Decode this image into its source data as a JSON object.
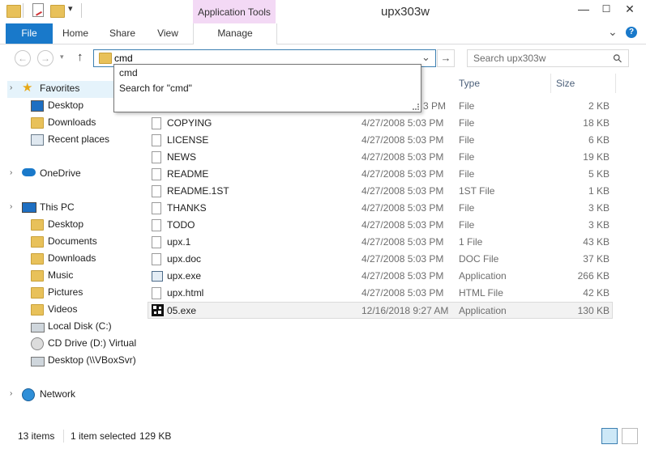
{
  "window": {
    "title": "upx303w",
    "minimize_glyph": "—",
    "maximize_glyph": "☐",
    "close_glyph": "✕"
  },
  "ribbon": {
    "context_group": "Application Tools",
    "tabs": {
      "file": "File",
      "home": "Home",
      "share": "Share",
      "view": "View",
      "manage": "Manage"
    },
    "collapse_glyph": "⌄",
    "help_glyph": "?"
  },
  "address_bar": {
    "value": "cmd",
    "back_glyph": "←",
    "forward_glyph": "→",
    "up_glyph": "↑",
    "dropdown_glyph": "⌄",
    "go_glyph": "→"
  },
  "search": {
    "placeholder": "Search upx303w",
    "icon_glyph": "⚲"
  },
  "autocomplete": {
    "items": [
      "cmd",
      "Search for \"cmd\""
    ]
  },
  "nav_pane": {
    "favorites": "Favorites",
    "fav_items": [
      "Desktop",
      "Downloads",
      "Recent places"
    ],
    "onedrive": "OneDrive",
    "this_pc": "This PC",
    "pc_items": [
      "Desktop",
      "Documents",
      "Downloads",
      "Music",
      "Pictures",
      "Videos",
      "Local Disk (C:)",
      "CD Drive (D:) Virtual",
      "Desktop (\\\\VBoxSvr)"
    ],
    "network": "Network"
  },
  "columns": {
    "type": "Type",
    "size": "Size"
  },
  "files": [
    {
      "name": "",
      "date": "",
      "time_tail": "3 PM",
      "type": "File",
      "size": "2 KB"
    },
    {
      "name": "COPYING",
      "date": "4/27/2008 5:03 PM",
      "type": "File",
      "size": "18 KB"
    },
    {
      "name": "LICENSE",
      "date": "4/27/2008 5:03 PM",
      "type": "File",
      "size": "6 KB"
    },
    {
      "name": "NEWS",
      "date": "4/27/2008 5:03 PM",
      "type": "File",
      "size": "19 KB"
    },
    {
      "name": "README",
      "date": "4/27/2008 5:03 PM",
      "type": "File",
      "size": "5 KB"
    },
    {
      "name": "README.1ST",
      "date": "4/27/2008 5:03 PM",
      "type": "1ST File",
      "size": "1 KB"
    },
    {
      "name": "THANKS",
      "date": "4/27/2008 5:03 PM",
      "type": "File",
      "size": "3 KB"
    },
    {
      "name": "TODO",
      "date": "4/27/2008 5:03 PM",
      "type": "File",
      "size": "3 KB"
    },
    {
      "name": "upx.1",
      "date": "4/27/2008 5:03 PM",
      "type": "1 File",
      "size": "43 KB"
    },
    {
      "name": "upx.doc",
      "date": "4/27/2008 5:03 PM",
      "type": "DOC File",
      "size": "37 KB"
    },
    {
      "name": "upx.exe",
      "date": "4/27/2008 5:03 PM",
      "type": "Application",
      "size": "266 KB"
    },
    {
      "name": "upx.html",
      "date": "4/27/2008 5:03 PM",
      "type": "HTML File",
      "size": "42 KB"
    },
    {
      "name": "05.exe",
      "date": "12/16/2018 9:27 AM",
      "type": "Application",
      "size": "130 KB"
    }
  ],
  "status_bar": {
    "count": "13 items",
    "selection": "1 item selected",
    "selection_size": "129 KB"
  },
  "colors": {
    "accent": "#1979ca",
    "context_tab": "#f3d9f5",
    "address_border": "#3c7fb1"
  }
}
